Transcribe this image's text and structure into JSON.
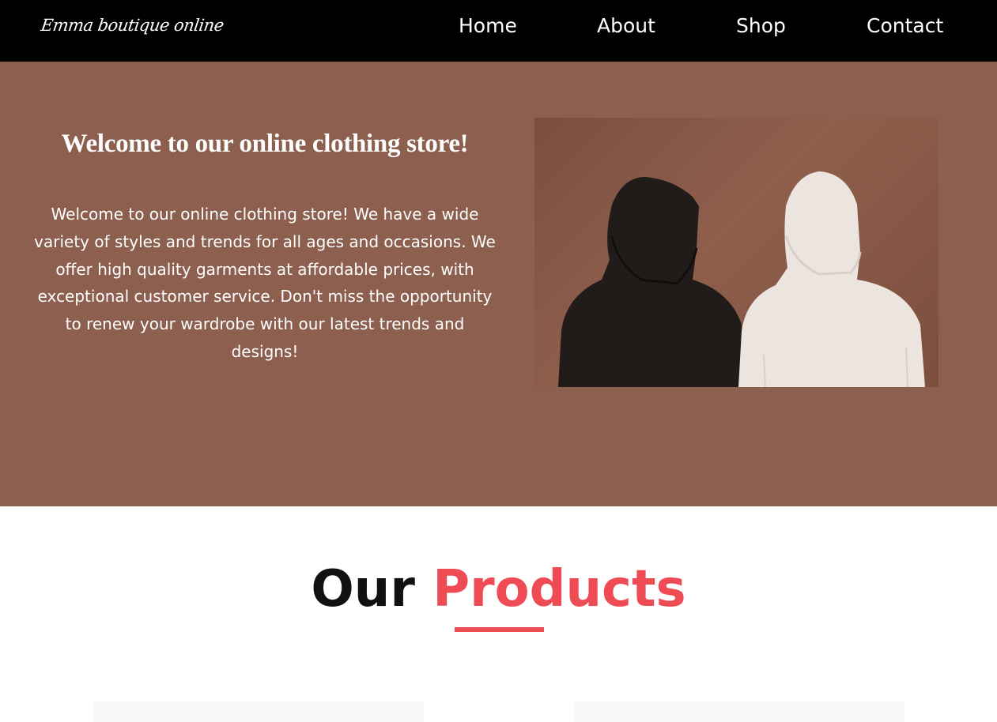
{
  "header": {
    "logo": "Emma boutique online",
    "nav": {
      "home": "Home",
      "about": "About",
      "shop": "Shop",
      "contact": "Contact"
    }
  },
  "hero": {
    "title": "Welcome to our online clothing store!",
    "text": "Welcome to our online clothing store! We have a wide variety of styles and trends for all ages and occasions. We offer high quality garments at affordable prices, with exceptional customer service. Don't miss the opportunity to renew your wardrobe with our latest trends and designs!",
    "background_color": "#8c5f4e"
  },
  "products": {
    "heading_part1": "Our",
    "heading_part2": "Products",
    "accent_color": "#ef4b55"
  }
}
